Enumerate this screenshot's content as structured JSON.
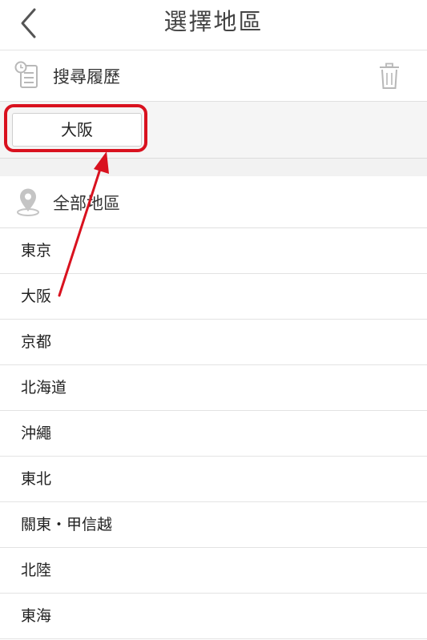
{
  "header": {
    "title": "選擇地區",
    "back_icon": "chevron-left-icon"
  },
  "history": {
    "label": "搜尋履歷",
    "icon": "history-list-icon",
    "clear_icon": "trash-icon",
    "items": [
      "大阪"
    ]
  },
  "all_regions": {
    "label": "全部地區",
    "icon": "location-pin-icon"
  },
  "regions": [
    "東京",
    "大阪",
    "京都",
    "北海道",
    "沖繩",
    "東北",
    "關東・甲信越",
    "北陸",
    "東海"
  ],
  "colors": {
    "highlight": "#d9121f",
    "icon_gray": "#b8b8b8",
    "divider": "#e3e3e3",
    "band": "#f5f5f5"
  }
}
